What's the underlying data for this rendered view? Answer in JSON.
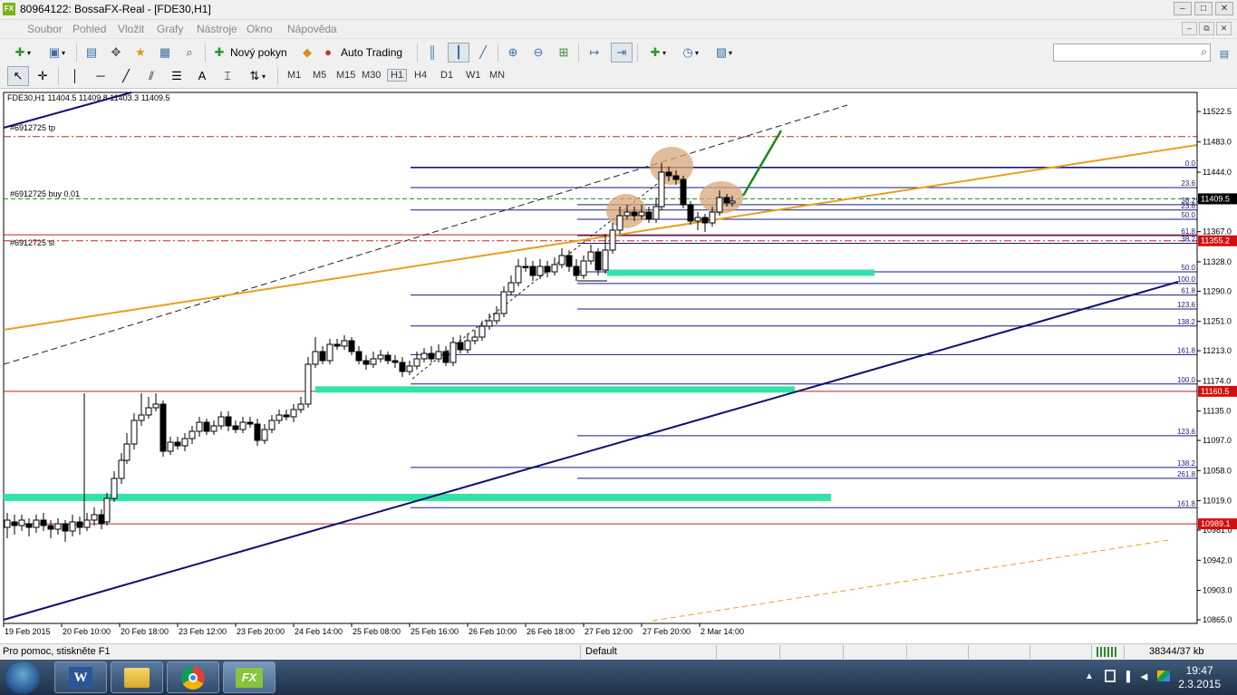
{
  "window": {
    "title": "80964122: BossaFX-Real - [FDE30,H1]",
    "app_icon_label": "FX",
    "controls": [
      "–",
      "□",
      "✕"
    ]
  },
  "menu": {
    "items": [
      "Soubor",
      "Pohled",
      "Vložit",
      "Grafy",
      "Nástroje",
      "Okno",
      "Nápověda"
    ],
    "mdi_controls": [
      "–",
      "⧉",
      "✕"
    ]
  },
  "toolbar": {
    "new_order_label": "Nový pokyn",
    "auto_trading_label": "Auto Trading",
    "search_placeholder": ""
  },
  "timeframes": {
    "items": [
      "M1",
      "M5",
      "M15",
      "M30",
      "H1",
      "H4",
      "D1",
      "W1",
      "MN"
    ],
    "active": "H1"
  },
  "chart": {
    "header": "FDE30,H1  11404.5 11409.8 11403.3 11409.5",
    "order_labels": {
      "tp": "#6912725 tp",
      "buy": "#6912725 buy 0.01",
      "sl": "#6912725 sl"
    },
    "price_labels": [
      "11522.5",
      "11483.0",
      "11444.0",
      "11406.0",
      "11367.0",
      "11328.0",
      "11290.0",
      "11251.0",
      "11213.0",
      "11174.0",
      "11135.0",
      "11097.0",
      "11058.0",
      "11019.0",
      "10981.0",
      "10942.0",
      "10903.0",
      "10865.0"
    ],
    "price_tags": [
      {
        "value": "11409.5",
        "color": "#000000"
      },
      {
        "value": "11355.2",
        "color": "#d01010"
      },
      {
        "value": "11160.5",
        "color": "#d01010"
      },
      {
        "value": "10989.1",
        "color": "#d01010"
      }
    ],
    "time_labels": [
      "19 Feb 2015",
      "20 Feb 10:00",
      "20 Feb 18:00",
      "23 Feb 12:00",
      "23 Feb 20:00",
      "24 Feb 14:00",
      "25 Feb 08:00",
      "25 Feb 16:00",
      "26 Feb 10:00",
      "26 Feb 18:00",
      "27 Feb 12:00",
      "27 Feb 20:00",
      "2 Mar 14:00"
    ],
    "fib_levels": [
      {
        "label": "0.0",
        "price": 11450
      },
      {
        "label": "23.6",
        "price": 11424
      },
      {
        "label": "38.2",
        "price": 11402
      },
      {
        "label": "23.6",
        "price": 11395
      },
      {
        "label": "50.0",
        "price": 11383
      },
      {
        "label": "61.8",
        "price": 11362
      },
      {
        "label": "38.2",
        "price": 11352
      },
      {
        "label": "50.0",
        "price": 11315
      },
      {
        "label": "100.0",
        "price": 11300
      },
      {
        "label": "61.8",
        "price": 11285
      },
      {
        "label": "123.6",
        "price": 11267
      },
      {
        "label": "138.2",
        "price": 11245
      },
      {
        "label": "161.8",
        "price": 11208
      },
      {
        "label": "100.0",
        "price": 11170
      },
      {
        "label": "123.6",
        "price": 11103
      },
      {
        "label": "138.2",
        "price": 11062
      },
      {
        "label": "261.8",
        "price": 11048
      },
      {
        "label": "161.8",
        "price": 11010
      }
    ],
    "colors": {
      "fib": "#1a1a80",
      "trend_orange": "#e8a020",
      "channel_blue": "#10106e",
      "zone_green": "#33e3a6",
      "highlight": "#d9a67a",
      "order_green": "#1a8a1a",
      "order_red": "#d02020"
    }
  },
  "status": {
    "help_text": "Pro pomoc, stiskněte F1",
    "profile": "Default",
    "traffic": "38344/37 kb"
  },
  "taskbar": {
    "clock_time": "19:47",
    "clock_date": "2.3.2015",
    "apps": [
      "word-icon",
      "explorer-icon",
      "chrome-icon",
      "fx-icon"
    ]
  }
}
